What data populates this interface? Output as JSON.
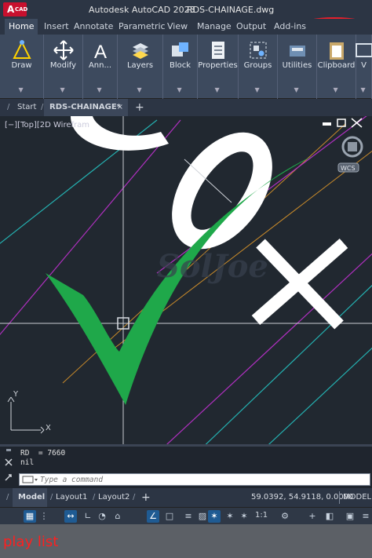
{
  "titlebar": {
    "logo_text": "A",
    "logo_sub": "CAD",
    "app_name": "Autodesk AutoCAD 2023",
    "file_name": "RDS-CHAINAGE.dwg",
    "watermark": "SolidJoe"
  },
  "ribbon_tabs": [
    "Home",
    "Insert",
    "Annotate",
    "Parametric",
    "View",
    "Manage",
    "Output",
    "Add-ins"
  ],
  "active_ribbon_tab": "Home",
  "ribbon_panels": [
    {
      "label": "Draw",
      "icon": "draw-icon"
    },
    {
      "label": "Modify",
      "icon": "move-icon"
    },
    {
      "label": "Ann...",
      "icon": "annotation-icon"
    },
    {
      "label": "Layers",
      "icon": "layers-icon"
    },
    {
      "label": "Block",
      "icon": "block-icon"
    },
    {
      "label": "Properties",
      "icon": "properties-icon"
    },
    {
      "label": "Groups",
      "icon": "groups-icon"
    },
    {
      "label": "Utilities",
      "icon": "utilities-icon"
    },
    {
      "label": "Clipboard",
      "icon": "clipboard-icon"
    },
    {
      "label": "V",
      "icon": "view-icon"
    }
  ],
  "doc_tabs": {
    "start": "Start",
    "active": "RDS-CHAINAGE*",
    "close": "×",
    "add": "+"
  },
  "viewport": {
    "label": "[−][Top][2D Wirefram",
    "wcs": "WCS",
    "ucs_x": "X",
    "ucs_y": "Y"
  },
  "command": {
    "history": [
      "RD  = 7660",
      "nil"
    ],
    "placeholder": "Type a command"
  },
  "layout_tabs": [
    "Model",
    "Layout1",
    "Layout2"
  ],
  "layout_add": "+",
  "status": {
    "coords": "59.0392, 54.9118, 0.0000",
    "mode": "MODEL",
    "scale": "1:1"
  },
  "overlay": {
    "playlist": "play list"
  }
}
